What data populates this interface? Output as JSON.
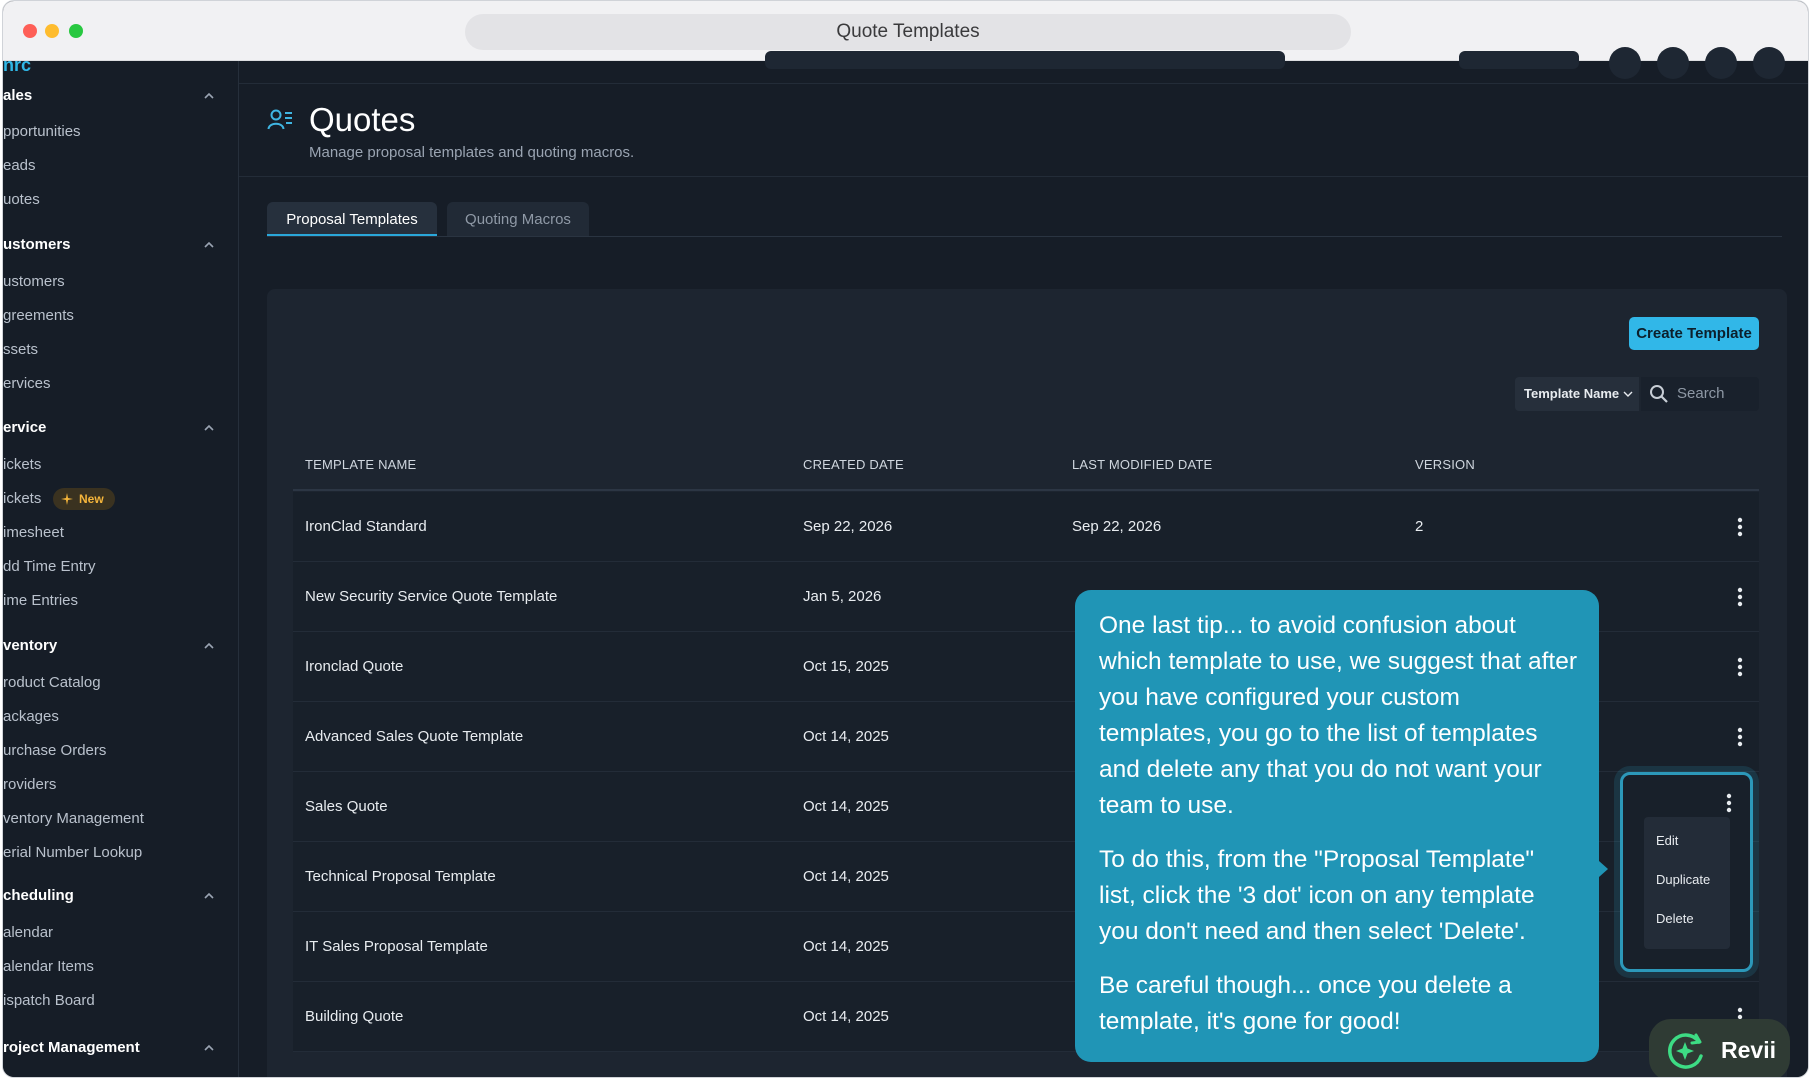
{
  "window": {
    "url_title": "Quote Templates"
  },
  "sidebar": {
    "logo": "nrc",
    "sections": [
      {
        "label": "ales",
        "items": [
          "pportunities",
          "eads",
          "uotes"
        ]
      },
      {
        "label": "ustomers",
        "items": [
          "ustomers",
          "greements",
          "ssets",
          "ervices"
        ]
      },
      {
        "label": "ervice",
        "items": [
          "ickets",
          "ickets",
          "imesheet",
          "dd Time Entry",
          "ime Entries"
        ]
      },
      {
        "label": "ventory",
        "items": [
          "roduct Catalog",
          "ackages",
          "urchase Orders",
          "roviders",
          "ventory Management",
          "erial Number Lookup"
        ]
      },
      {
        "label": "cheduling",
        "items": [
          "alendar",
          "alendar Items",
          "ispatch Board"
        ]
      },
      {
        "label": "roject Management",
        "items": []
      }
    ],
    "new_badge": "New"
  },
  "page": {
    "title": "Quotes",
    "subtitle": "Manage proposal templates and quoting macros."
  },
  "tabs": [
    {
      "label": "Proposal Templates",
      "active": true
    },
    {
      "label": "Quoting Macros",
      "active": false
    }
  ],
  "toolbar": {
    "create_label": "Create Template",
    "filter_select": "Template Name",
    "search_placeholder": "Search"
  },
  "table": {
    "headers": [
      "TEMPLATE NAME",
      "CREATED DATE",
      "LAST MODIFIED DATE",
      "VERSION"
    ],
    "rows": [
      {
        "name": "IronClad Standard",
        "created": "Sep 22, 2026",
        "modified": "Sep 22, 2026",
        "version": "2"
      },
      {
        "name": "New Security Service Quote Template",
        "created": "Jan 5, 2026",
        "modified": "",
        "version": ""
      },
      {
        "name": "Ironclad Quote",
        "created": "Oct 15, 2025",
        "modified": "",
        "version": ""
      },
      {
        "name": "Advanced Sales Quote Template",
        "created": "Oct 14, 2025",
        "modified": "",
        "version": ""
      },
      {
        "name": "Sales Quote",
        "created": "Oct 14, 2025",
        "modified": "",
        "version": ""
      },
      {
        "name": "Technical Proposal Template",
        "created": "Oct 14, 2025",
        "modified": "",
        "version": ""
      },
      {
        "name": "IT Sales Proposal Template",
        "created": "Oct 14, 2025",
        "modified": "",
        "version": ""
      },
      {
        "name": "Building Quote",
        "created": "Oct 14, 2025",
        "modified": "",
        "version": ""
      }
    ]
  },
  "context_menu": {
    "items": [
      "Edit",
      "Duplicate",
      "Delete"
    ]
  },
  "tooltip": {
    "paragraphs": [
      "One last tip... to avoid confusion about which template to use, we suggest that after you have configured your custom templates, you go to the list of templates and delete any that you do not want your team to use.",
      "To do this, from the \"Proposal Template\" list, click the '3 dot' icon on any template you don't need and then select 'Delete'.",
      "Be careful though... once you delete a template, it's gone for good!"
    ]
  },
  "assistant": {
    "label": "Revii"
  },
  "colors": {
    "accent": "#31b7e8",
    "tooltip": "#2095b6",
    "background": "#161d27",
    "badge": "#f5b53b"
  }
}
